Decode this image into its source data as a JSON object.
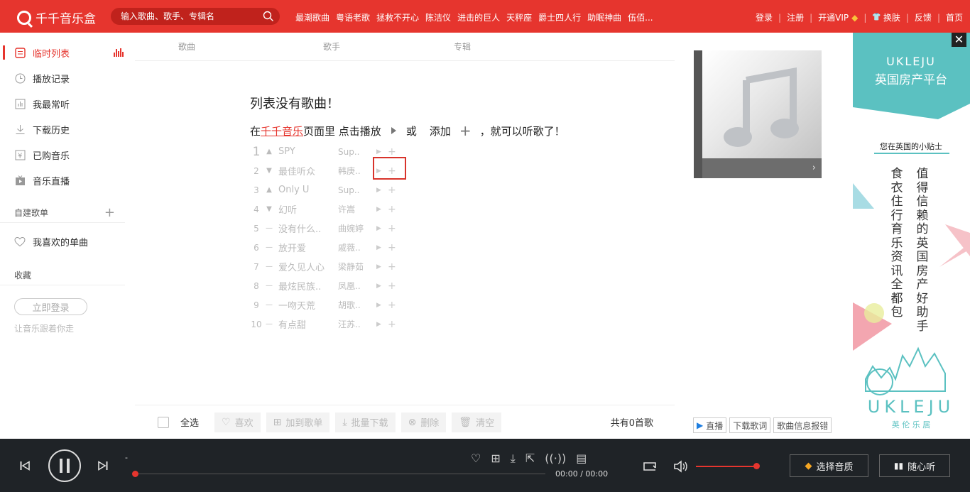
{
  "app": {
    "title": "千千音乐盒",
    "brand_color": "#e6352e"
  },
  "search": {
    "placeholder": "输入歌曲、歌手、专辑名"
  },
  "hot_links": [
    "最潮歌曲",
    "粤语老歌",
    "拯救不开心",
    "陈洁仪",
    "进击的巨人",
    "天秤座",
    "爵士四人行",
    "助眠神曲",
    "伍佰..."
  ],
  "top_right": {
    "login": "登录",
    "register": "注册",
    "vip": "开通VIP",
    "skin": "换肤",
    "feedback": "反馈",
    "home": "首页"
  },
  "sidebar": {
    "items": [
      {
        "label": "临时列表",
        "icon": "list-icon"
      },
      {
        "label": "播放记录",
        "icon": "clock-icon"
      },
      {
        "label": "我最常听",
        "icon": "chart-icon"
      },
      {
        "label": "下载历史",
        "icon": "download-icon"
      },
      {
        "label": "已购音乐",
        "icon": "yen-icon"
      },
      {
        "label": "音乐直播",
        "icon": "live-icon"
      }
    ],
    "custom_playlist_title": "自建歌单",
    "favorite": "我喜欢的单曲",
    "collection_title": "收藏",
    "login_button": "立即登录",
    "login_tip": "让音乐跟着你走"
  },
  "columns": {
    "song": "歌曲",
    "artist": "歌手",
    "album": "专辑"
  },
  "empty": {
    "title": "列表没有歌曲！",
    "line_prefix": "在",
    "link": "千千音乐",
    "line_mid": "页面里 点击播放",
    "or": "或",
    "add": "添加",
    "line_suffix": "，就可以听歌了！"
  },
  "rank": [
    {
      "n": "1",
      "trend": "▲",
      "name": "SPY",
      "artist": "Sup.."
    },
    {
      "n": "2",
      "trend": "▼",
      "name": "最佳听众",
      "artist": "韩庚.."
    },
    {
      "n": "3",
      "trend": "▲",
      "name": "Only U",
      "artist": "Sup.."
    },
    {
      "n": "4",
      "trend": "▼",
      "name": "幻听",
      "artist": "许嵩"
    },
    {
      "n": "5",
      "trend": "—",
      "name": "没有什么..",
      "artist": "曲婉婷"
    },
    {
      "n": "6",
      "trend": "—",
      "name": "放开爱",
      "artist": "戚薇.."
    },
    {
      "n": "7",
      "trend": "—",
      "name": "爱久见人心",
      "artist": "梁静茹"
    },
    {
      "n": "8",
      "trend": "—",
      "name": "最炫民族..",
      "artist": "凤凰.."
    },
    {
      "n": "9",
      "trend": "—",
      "name": "一吻天荒",
      "artist": "胡歌.."
    },
    {
      "n": "10",
      "trend": "—",
      "name": "有点甜",
      "artist": "汪苏.."
    }
  ],
  "actions": {
    "select_all": "全选",
    "like": "喜欢",
    "add_to": "加到歌单",
    "batch_download": "批量下载",
    "delete": "删除",
    "clear": "清空",
    "total": "共有0首歌"
  },
  "side_buttons": {
    "live": "直播",
    "lyrics": "下载歌词",
    "report": "歌曲信息报错"
  },
  "ad": {
    "brand": "UKLEJU",
    "subtitle": "英国房产平台",
    "tip": "您在英国的小贴士",
    "col1": "值得信赖的英国房产好助手",
    "col2": "食衣住行育乐资讯全都包",
    "logo_text": "UKLEJU",
    "logo_cn": "英 伦 乐 居"
  },
  "player": {
    "song_dash": "-",
    "time": "00:00 / 00:00",
    "quality": "选择音质",
    "radio": "随心听"
  }
}
